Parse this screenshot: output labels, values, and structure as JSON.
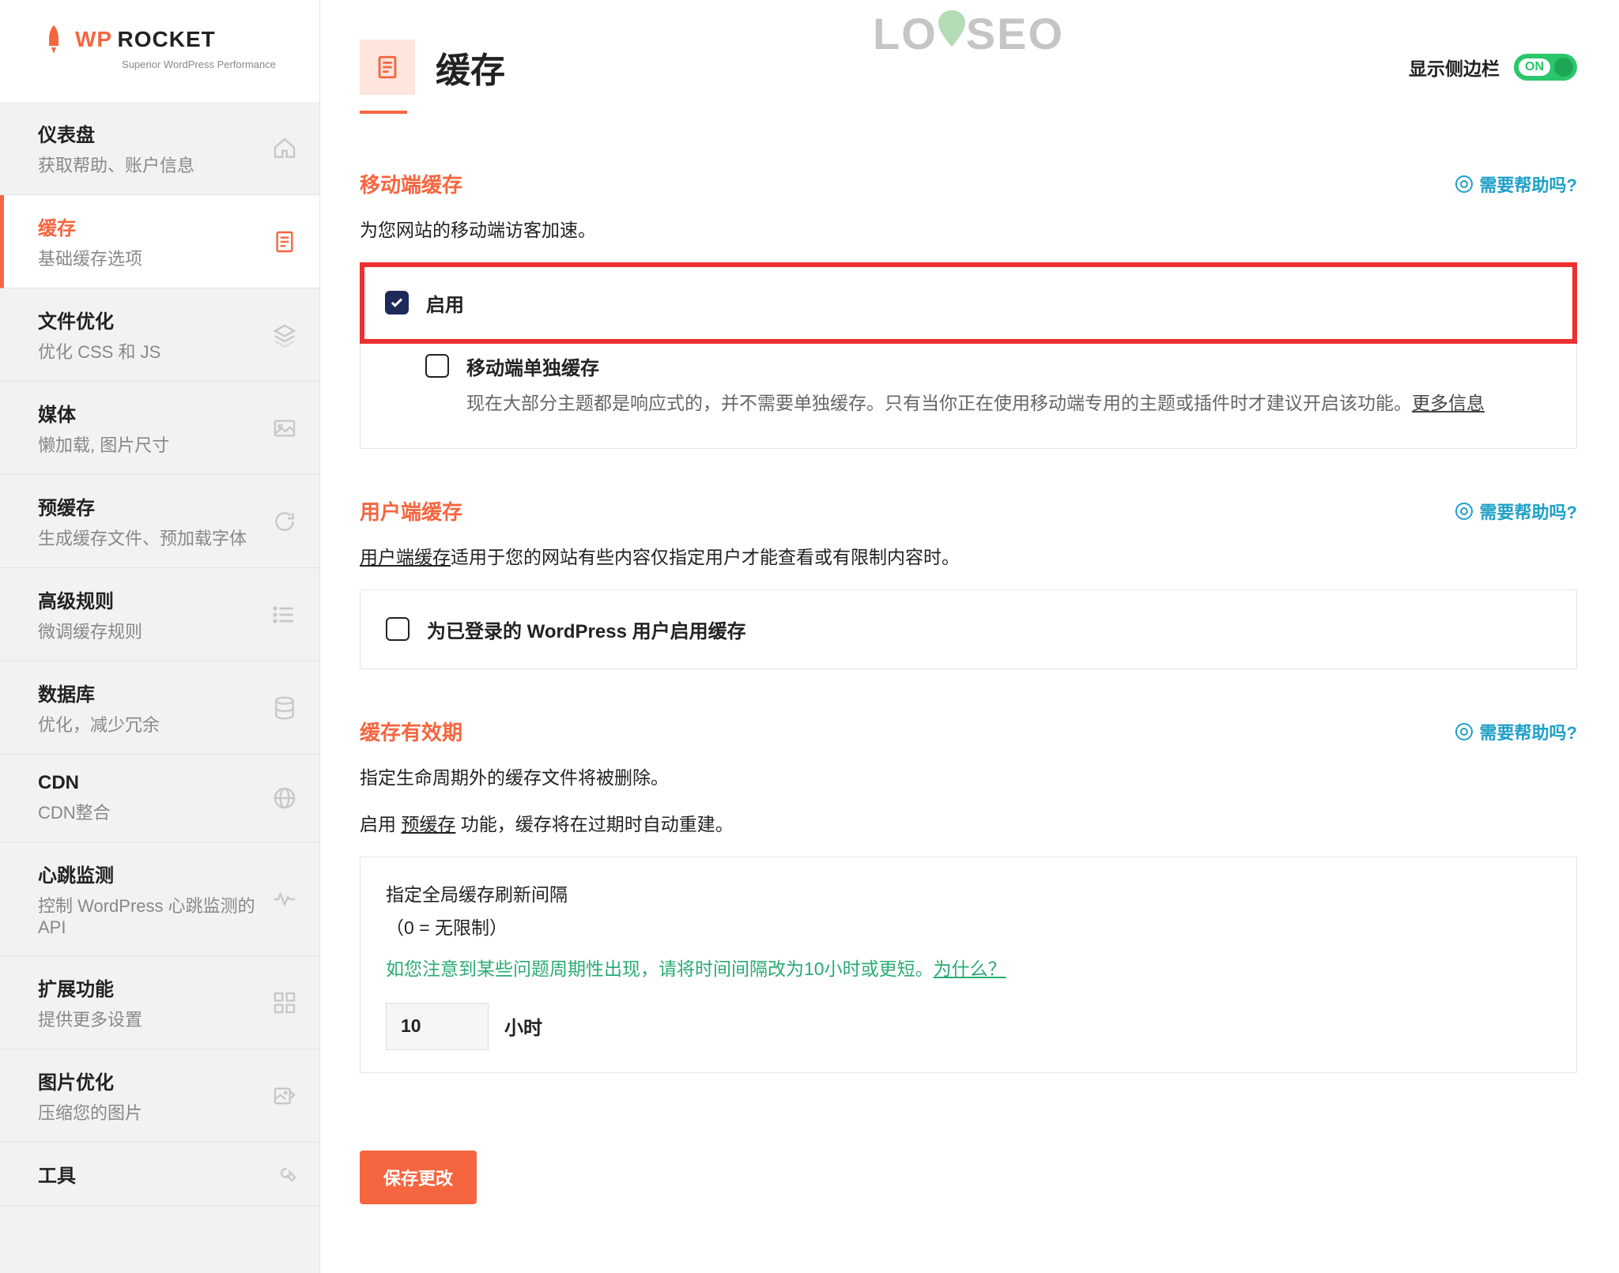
{
  "logo": {
    "wp": "WP",
    "rocket": "ROCKET",
    "sub": "Superior WordPress Performance"
  },
  "watermark": {
    "lo": "LO",
    "seo": "SEO"
  },
  "nav": [
    {
      "title": "仪表盘",
      "sub": "获取帮助、账户信息",
      "icon": "home"
    },
    {
      "title": "缓存",
      "sub": "基础缓存选项",
      "icon": "doc",
      "active": true
    },
    {
      "title": "文件优化",
      "sub": "优化 CSS 和 JS",
      "icon": "layers"
    },
    {
      "title": "媒体",
      "sub": "懒加载, 图片尺寸",
      "icon": "image"
    },
    {
      "title": "预缓存",
      "sub": "生成缓存文件、预加载字体",
      "icon": "refresh"
    },
    {
      "title": "高级规则",
      "sub": "微调缓存规则",
      "icon": "list"
    },
    {
      "title": "数据库",
      "sub": "优化，减少冗余",
      "icon": "db"
    },
    {
      "title": "CDN",
      "sub": "CDN整合",
      "icon": "globe"
    },
    {
      "title": "心跳监测",
      "sub": "控制 WordPress 心跳监测的 API",
      "icon": "heart"
    },
    {
      "title": "扩展功能",
      "sub": "提供更多设置",
      "icon": "boxes"
    },
    {
      "title": "图片优化",
      "sub": "压缩您的图片",
      "icon": "imgopt"
    },
    {
      "title": "工具",
      "sub": "",
      "icon": "tools"
    }
  ],
  "header": {
    "title": "缓存",
    "toggleSide": "显示侧边栏",
    "toggleOn": "ON"
  },
  "help": "需要帮助吗?",
  "section1": {
    "title": "移动端缓存",
    "desc": "为您网站的移动端访客加速。",
    "enable": "启用",
    "sep_title": "移动端单独缓存",
    "sep_desc": "现在大部分主题都是响应式的，并不需要单独缓存。只有当你正在使用移动端专用的主题或插件时才建议开启该功能。",
    "more": "更多信息"
  },
  "section2": {
    "title": "用户端缓存",
    "desc_link": "用户端缓存",
    "desc_rest": "适用于您的网站有些内容仅指定用户才能查看或有限制内容时。",
    "checkbox": "为已登录的 WordPress 用户启用缓存"
  },
  "section3": {
    "title": "缓存有效期",
    "desc1": "指定生命周期外的缓存文件将被删除。",
    "desc2_a": "启用 ",
    "desc2_link": "预缓存",
    "desc2_b": " 功能，缓存将在过期时自动重建。",
    "box_title": "指定全局缓存刷新间隔",
    "box_sub": "（0 = 无限制）",
    "hint_a": "如您注意到某些问题周期性出现，请将时间间隔改为10小时或更短。",
    "hint_link": "为什么？",
    "value": "10",
    "unit": "小时"
  },
  "save": "保存更改"
}
